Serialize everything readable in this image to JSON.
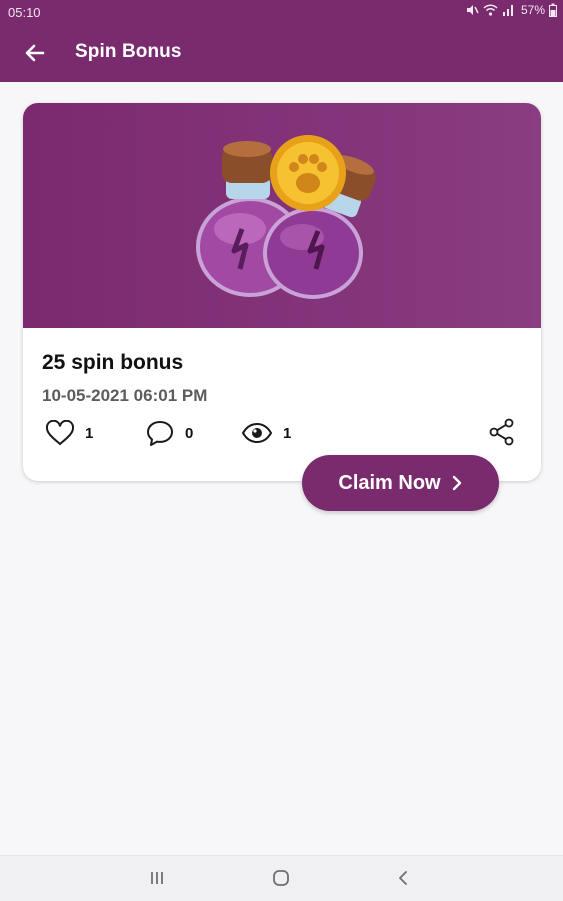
{
  "status_bar": {
    "time": "05:10",
    "battery": "57%",
    "icons": [
      "mute-icon",
      "wifi-icon",
      "signal-icon",
      "battery-icon"
    ]
  },
  "app_bar": {
    "title": "Spin Bonus",
    "back_icon": "arrow-left-icon"
  },
  "post": {
    "title": "25 spin bonus",
    "date": "10-05-2021 06:01 PM",
    "likes": "1",
    "comments": "0",
    "views": "1",
    "image_icon": "potions-coin-illustration"
  },
  "claim_button": {
    "label": "Claim Now",
    "icon": "chevron-right-icon"
  },
  "nav_bar": {
    "buttons": [
      "recents-icon",
      "home-icon",
      "back-icon"
    ]
  },
  "colors": {
    "brand": "#7a2b6e",
    "background": "#f7f7f9",
    "card": "#ffffff"
  }
}
